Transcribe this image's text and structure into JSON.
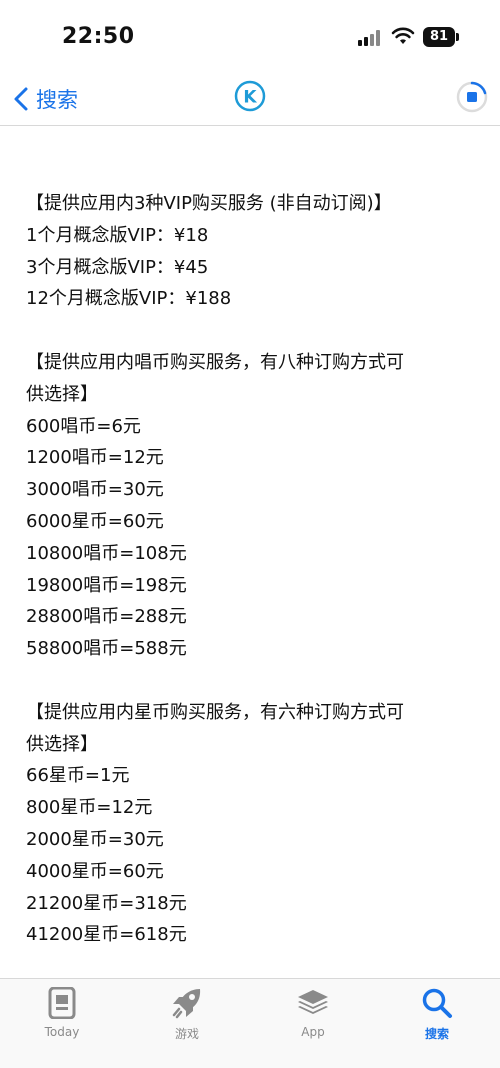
{
  "status_bar": {
    "time": "22:50",
    "battery": "81"
  },
  "nav": {
    "back_label": "搜索",
    "app_icon_letter": "K"
  },
  "colors": {
    "accent": "#1a73e8",
    "app_icon_blue": "#1e9bd7"
  },
  "icons": {
    "back": "chevron-left-icon",
    "progress": "download-progress-icon",
    "tabs": [
      "today-icon",
      "rocket-icon",
      "stack-icon",
      "search-icon"
    ]
  },
  "content": {
    "lines": [
      "【提供应用内3种VIP购买服务 (非自动订阅)】",
      "1个月概念版VIP：¥18",
      "3个月概念版VIP：¥45",
      "12个月概念版VIP：¥188",
      "",
      "【提供应用内唱币购买服务，有八种订购方式可",
      "供选择】",
      "600唱币=6元",
      "1200唱币=12元",
      "3000唱币=30元",
      "6000星币=60元",
      "10800唱币=108元",
      "19800唱币=198元",
      "28800唱币=288元",
      "58800唱币=588元",
      "",
      "【提供应用内星币购买服务，有六种订购方式可",
      "供选择】",
      "66星币=1元",
      "800星币=12元",
      "2000星币=30元",
      "4000星币=60元",
      "21200星币=318元",
      "41200星币=618元"
    ]
  },
  "tab_bar": {
    "active_index": 3,
    "tabs": [
      {
        "label": "Today"
      },
      {
        "label": "游戏"
      },
      {
        "label": "App"
      },
      {
        "label": "搜索"
      }
    ]
  }
}
